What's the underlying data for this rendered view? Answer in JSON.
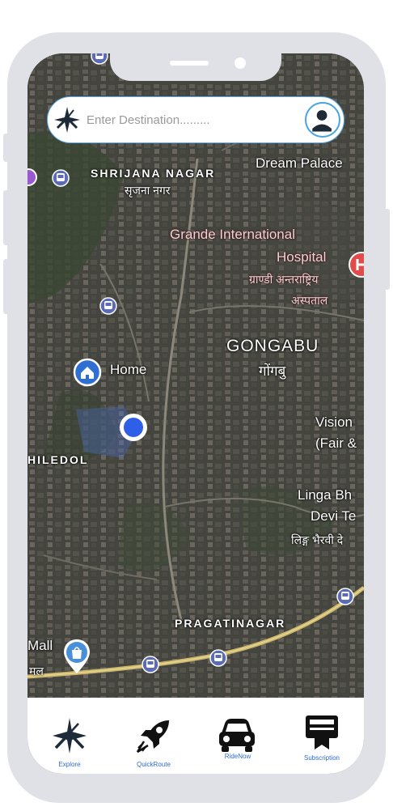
{
  "search": {
    "placeholder": "Enter Destination........."
  },
  "map": {
    "labels": {
      "dream_palace": "Dream Palace",
      "shrijana_nagar": "SHRIJANA NAGAR",
      "shrijana_nagar_np": "सृजना नगर",
      "grande_1": "Grande International",
      "grande_2": "Hospital",
      "grande_np_1": "ग्राण्डी अन्तराष्ट्रिय",
      "grande_np_2": "अस्पताल",
      "gongabu": "GONGABU",
      "gongabu_np": "गोंगबु",
      "home": "Home",
      "vision_1": "Vision",
      "vision_2": "(Fair &",
      "hiledol": "HILEDOL",
      "linga_1": "Linga Bh",
      "linga_2": "Devi Te",
      "linga_np": "लिङ्ग भैरवी दे",
      "pragatinagar": "PRAGATINAGAR",
      "mall": "Mall",
      "mall_np": "मल"
    }
  },
  "nav": {
    "items": [
      {
        "label": "Explore",
        "icon": "explore-star-icon"
      },
      {
        "label": "QuickRoute",
        "icon": "rocket-icon"
      },
      {
        "label": "RideNow",
        "icon": "car-icon"
      },
      {
        "label": "Subscription",
        "icon": "subscription-icon"
      }
    ],
    "label_color": "#2d6bd6"
  },
  "colors": {
    "phone_frame": "#dfe1e6",
    "search_border": "#5aa9e6",
    "location_dot": "#2f5ee8",
    "home_pin": "#2f6fd1",
    "hospital_pin": "#e04b4b"
  }
}
